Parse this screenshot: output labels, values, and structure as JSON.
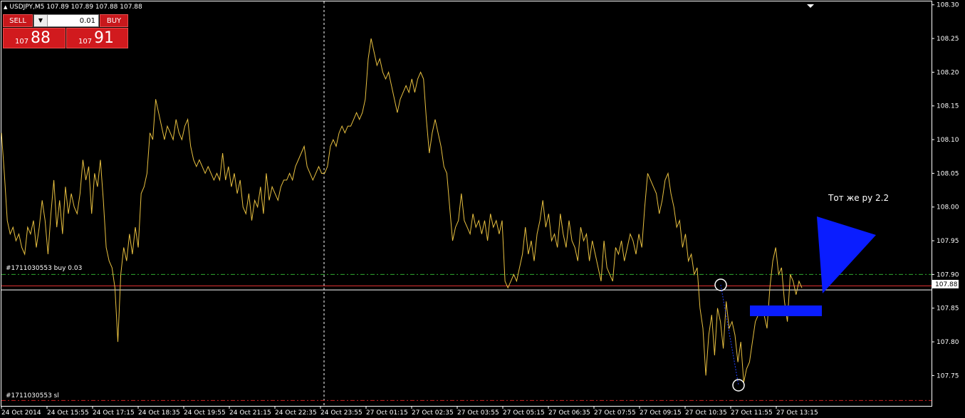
{
  "header": {
    "symbol_text": "USDJPY,M5  107.89 107.89 107.88 107.88"
  },
  "trade_panel": {
    "sell_label": "SELL",
    "buy_label": "BUY",
    "lot_value": "0.01",
    "bid_big": "107",
    "bid_small": "88",
    "ask_big": "107",
    "ask_small": "91"
  },
  "orders": {
    "buy_label": "#1711030553 buy 0.03",
    "sl_label": "#1711030553 sl"
  },
  "annotation": {
    "text": "Тот же ру 2.2"
  },
  "price_axis": {
    "current_price_label": "107.88"
  },
  "chart_data": {
    "type": "line",
    "title": "USDJPY,M5",
    "ylim": [
      107.705,
      108.305
    ],
    "y_ticks": [
      "108.30",
      "108.25",
      "108.20",
      "108.15",
      "108.10",
      "108.05",
      "108.00",
      "107.95",
      "107.90",
      "107.85",
      "107.80",
      "107.75"
    ],
    "x_ticks": [
      "24 Oct 2014",
      "24 Oct 15:55",
      "24 Oct 17:15",
      "24 Oct 18:35",
      "24 Oct 19:55",
      "24 Oct 21:15",
      "24 Oct 22:35",
      "24 Oct 23:55",
      "27 Oct 01:15",
      "27 Oct 02:35",
      "27 Oct 03:55",
      "27 Oct 05:15",
      "27 Oct 06:35",
      "27 Oct 07:55",
      "27 Oct 09:15",
      "27 Oct 10:35",
      "27 Oct 11:55",
      "27 Oct 13:15"
    ],
    "series": [
      {
        "color": "#e8c040",
        "values": [
          108.11,
          108.05,
          107.98,
          107.96,
          107.97,
          107.95,
          107.96,
          107.94,
          107.93,
          107.97,
          107.96,
          107.98,
          107.94,
          107.97,
          108.01,
          107.98,
          107.93,
          107.99,
          108.04,
          107.97,
          108.01,
          107.96,
          108.03,
          107.99,
          108.02,
          108.0,
          107.99,
          108.02,
          108.07,
          108.04,
          108.06,
          107.99,
          108.05,
          108.03,
          108.07,
          108.01,
          107.94,
          107.92,
          107.91,
          107.88,
          107.8,
          107.9,
          107.94,
          107.92,
          107.96,
          107.93,
          107.97,
          107.94,
          108.02,
          108.03,
          108.05,
          108.11,
          108.1,
          108.16,
          108.14,
          108.12,
          108.1,
          108.12,
          108.11,
          108.1,
          108.13,
          108.11,
          108.1,
          108.12,
          108.13,
          108.09,
          108.07,
          108.06,
          108.07,
          108.06,
          108.05,
          108.06,
          108.05,
          108.04,
          108.05,
          108.04,
          108.08,
          108.04,
          108.06,
          108.03,
          108.05,
          108.02,
          108.04,
          108.0,
          107.99,
          108.02,
          107.98,
          108.01,
          108.0,
          108.03,
          107.99,
          108.05,
          108.01,
          108.03,
          108.02,
          108.01,
          108.03,
          108.04,
          108.04,
          108.05,
          108.04,
          108.06,
          108.07,
          108.08,
          108.09,
          108.06,
          108.05,
          108.04,
          108.05,
          108.06,
          108.05,
          108.05,
          108.06,
          108.09,
          108.1,
          108.09,
          108.11,
          108.12,
          108.11,
          108.12,
          108.12,
          108.13,
          108.14,
          108.13,
          108.14,
          108.16,
          108.22,
          108.25,
          108.23,
          108.21,
          108.22,
          108.2,
          108.19,
          108.2,
          108.18,
          108.16,
          108.14,
          108.16,
          108.17,
          108.18,
          108.17,
          108.19,
          108.17,
          108.19,
          108.2,
          108.19,
          108.13,
          108.08,
          108.11,
          108.13,
          108.11,
          108.09,
          108.06,
          108.05,
          108.0,
          107.95,
          107.97,
          107.98,
          108.02,
          107.98,
          107.97,
          107.96,
          107.99,
          107.97,
          107.98,
          107.96,
          107.98,
          107.95,
          107.99,
          107.97,
          107.98,
          107.96,
          107.98,
          107.89,
          107.88,
          107.89,
          107.9,
          107.89,
          107.91,
          107.93,
          107.97,
          107.93,
          107.95,
          107.92,
          107.96,
          107.98,
          108.01,
          107.97,
          107.99,
          107.95,
          107.96,
          107.94,
          107.99,
          107.96,
          107.94,
          107.98,
          107.95,
          107.94,
          107.92,
          107.97,
          107.95,
          107.96,
          107.92,
          107.95,
          107.93,
          107.91,
          107.89,
          107.95,
          107.91,
          107.9,
          107.89,
          107.94,
          107.93,
          107.95,
          107.92,
          107.94,
          107.96,
          107.95,
          107.93,
          107.96,
          107.94,
          108.0,
          108.05,
          108.04,
          108.03,
          108.02,
          107.99,
          108.01,
          108.04,
          108.05,
          108.02,
          108.0,
          107.97,
          107.98,
          107.94,
          107.96,
          107.92,
          107.93,
          107.9,
          107.91,
          107.85,
          107.82,
          107.75,
          107.81,
          107.84,
          107.78,
          107.85,
          107.83,
          107.79,
          107.86,
          107.82,
          107.83,
          107.81,
          107.77,
          107.8,
          107.74,
          107.76,
          107.77,
          107.8,
          107.83,
          107.84,
          107.85,
          107.84,
          107.82,
          107.88,
          107.92,
          107.94,
          107.9,
          107.91,
          107.86,
          107.83,
          107.9,
          107.89,
          107.87,
          107.89,
          107.88
        ]
      }
    ],
    "levels": {
      "take_profit": 107.9,
      "bid": 107.883,
      "ask": 107.877,
      "stop_loss": 107.713
    },
    "grid": false
  }
}
